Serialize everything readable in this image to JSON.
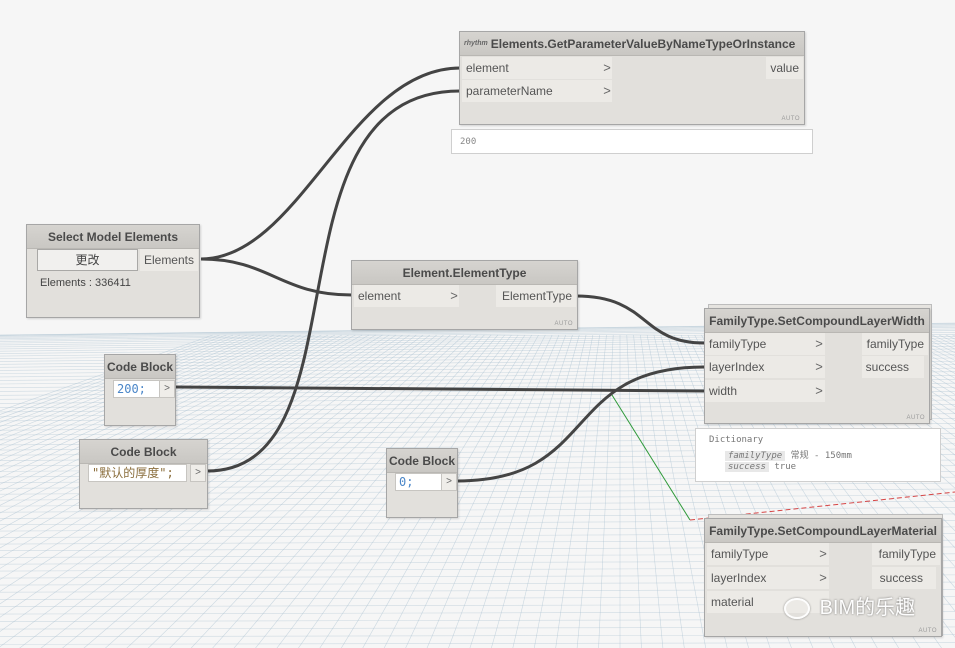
{
  "nodes": {
    "get_param": {
      "badge": "rhythm",
      "title": "Elements.GetParameterValueByNameTypeOrInstance",
      "inputs": [
        "element",
        "parameterName"
      ],
      "output": "value",
      "auto": "AUTO",
      "watch": "200"
    },
    "select_model": {
      "title": "Select Model Elements",
      "button_label": "更改",
      "output": "Elements",
      "status": "Elements : 336411"
    },
    "element_type": {
      "title": "Element.ElementType",
      "input": "element",
      "output": "ElementType",
      "auto": "AUTO"
    },
    "set_width": {
      "title": "FamilyType.SetCompoundLayerWidth",
      "inputs": [
        "familyType",
        "layerIndex",
        "width"
      ],
      "outputs": [
        "familyType",
        "success"
      ],
      "auto": "AUTO",
      "preview": {
        "header": "Dictionary",
        "rows": [
          {
            "key": "familyType",
            "value": "常规 - 150mm"
          },
          {
            "key": "success",
            "value": "true"
          }
        ]
      }
    },
    "set_material": {
      "title": "FamilyType.SetCompoundLayerMaterial",
      "inputs": [
        "familyType",
        "layerIndex",
        "material"
      ],
      "outputs": [
        "familyType",
        "success"
      ],
      "auto": "AUTO"
    },
    "code_200": {
      "title": "Code Block",
      "code": "200;"
    },
    "code_text": {
      "title": "Code Block",
      "code": "\"默认的厚度\";"
    },
    "code_0": {
      "title": "Code Block",
      "code": "0;"
    }
  },
  "port_arrow": ">",
  "watermark": "BIM的乐趣",
  "colors": {
    "wire": "#444444",
    "grid_line": "#a8bfcf",
    "axis_red": "#d64545",
    "axis_green": "#2f9a3a"
  }
}
